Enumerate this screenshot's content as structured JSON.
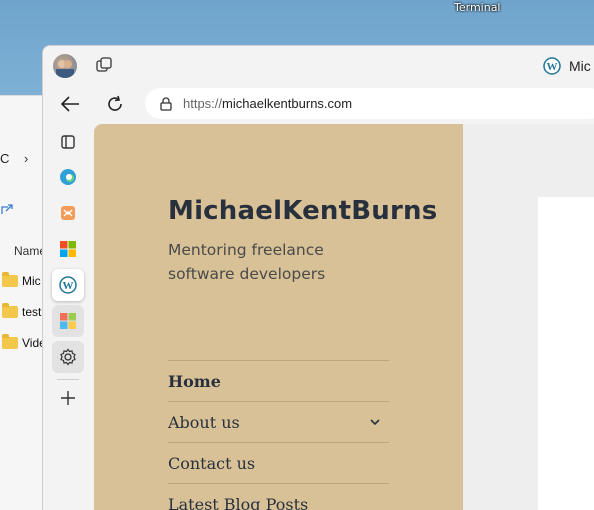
{
  "desktop": {
    "terminal_label": "Terminal"
  },
  "explorer": {
    "breadcrumb": "C",
    "name_header": "Name",
    "rows": [
      "Mic",
      "test",
      "Vide"
    ]
  },
  "browser": {
    "tab": {
      "label": "Mic"
    },
    "address": {
      "scheme": "https://",
      "host": "michaelkentburns.com"
    },
    "sidebar": [
      "tab-actions-icon",
      "edge-icon",
      "drop-icon",
      "office-icon",
      "wordpress-icon",
      "office-icon",
      "settings-icon",
      "add-icon"
    ]
  },
  "site": {
    "title": "MichaelKentBurns",
    "tagline": "Mentoring freelance software developers",
    "menu": [
      {
        "label": "Home"
      },
      {
        "label": "About us"
      },
      {
        "label": "Contact us"
      },
      {
        "label": "Latest Blog Posts"
      }
    ]
  },
  "colors": {
    "panel": "#d8c196",
    "title": "#28303d",
    "accent": "#0078d4"
  }
}
